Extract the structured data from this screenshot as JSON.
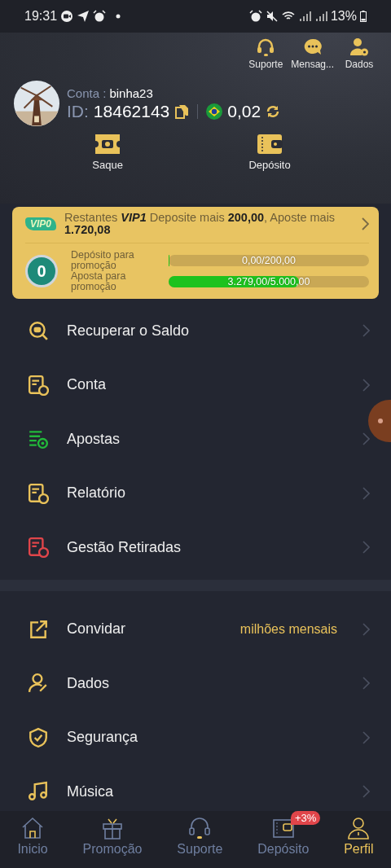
{
  "status_bar": {
    "time": "19:31",
    "battery": "13%"
  },
  "header": {
    "shortcuts": [
      {
        "label": "Suporte"
      },
      {
        "label": "Mensag..."
      },
      {
        "label": "Dados"
      }
    ],
    "account_label": "Conta :",
    "username": "binha23",
    "id_label": "ID:",
    "id": "18462143",
    "balance": "0,02",
    "actions": [
      {
        "label": "Saque"
      },
      {
        "label": "Depósito"
      }
    ]
  },
  "vip_card": {
    "badge": "VIP0",
    "message": "Restantes *VIP1* Deposite mais **200,00**, Aposte mais **1.720,08**",
    "level_badge": "0",
    "progress": [
      {
        "label": "Depósito para promoção",
        "reading": "0,00/200,00",
        "level": 0
      },
      {
        "label": "Aposta para promoção",
        "reading": "3.279,00/5.000,00",
        "level": 0.65
      }
    ]
  },
  "menu_groups": [
    [
      {
        "label": "Recuperar o Saldo"
      },
      {
        "label": "Conta"
      },
      {
        "label": "Apostas"
      },
      {
        "label": "Relatório"
      },
      {
        "label": "Gestão Retiradas"
      }
    ],
    [
      {
        "label": "Convidar",
        "note": "milhões mensais"
      },
      {
        "label": "Dados"
      },
      {
        "label": "Segurança"
      },
      {
        "label": "Música"
      }
    ]
  ],
  "bottom_nav": [
    {
      "label": "Inicio",
      "selected": false
    },
    {
      "label": "Promoção",
      "selected": false
    },
    {
      "label": "Suporte",
      "selected": false
    },
    {
      "label": "Depósito",
      "selected": false,
      "badge": "+3%"
    },
    {
      "label": "Perfil",
      "selected": true
    }
  ]
}
